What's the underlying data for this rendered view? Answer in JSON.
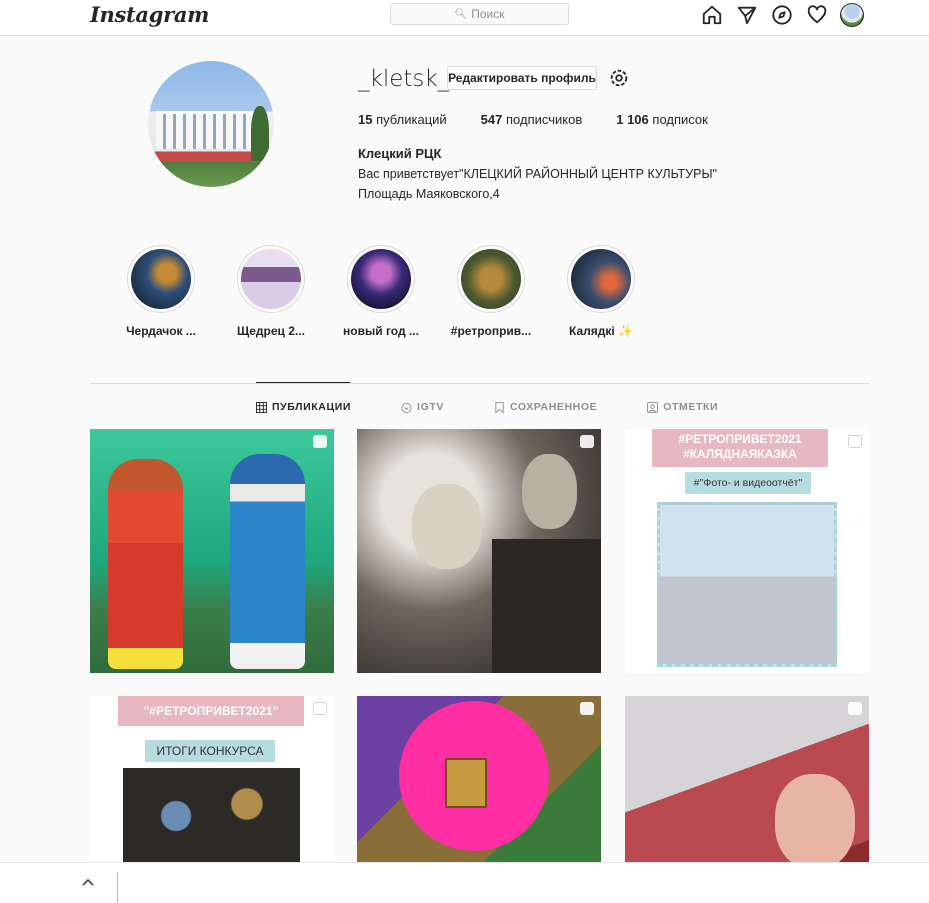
{
  "header": {
    "logo": "Instagram",
    "search_placeholder": "Поиск"
  },
  "profile": {
    "username": "_kletsk_",
    "edit_button": "Редактировать профиль",
    "stats": {
      "posts_count": "15",
      "posts_label": "публикаций",
      "followers_count": "547",
      "followers_label": "подписчиков",
      "following_count": "1 106",
      "following_label": "подписок"
    },
    "full_name": "Клецкий РЦК",
    "bio_line1": "Вас приветствует\"КЛЕЦКИЙ РАЙОННЫЙ ЦЕНТР КУЛЬТУРЫ\"",
    "bio_line2": "Площадь Маяковского,4"
  },
  "highlights": [
    {
      "label": "Чердачок ..."
    },
    {
      "label": "Щедрец 2..."
    },
    {
      "label": "новый год ..."
    },
    {
      "label": "#ретроприв..."
    },
    {
      "label": "Калядкі ✨"
    }
  ],
  "tabs": [
    {
      "label": "ПУБЛИКАЦИИ",
      "active": true
    },
    {
      "label": "IGTV",
      "active": false
    },
    {
      "label": "СОХРАНЕННОЕ",
      "active": false
    },
    {
      "label": "ОТМЕТКИ",
      "active": false
    }
  ],
  "posts": {
    "p3_banner_line1": "#РЕТРОПРИВЕТ2021",
    "p3_banner_line2": "#КАЛЯДНАЯКАЗКА",
    "p3_sub": "#\"Фото- и видеоотчёт\"",
    "p4_banner": "\"#РЕТРОПРИВЕТ2021\"",
    "p4_sub": "ИТОГИ КОНКУРСА"
  },
  "colors": {
    "text": "#262626",
    "muted": "#8e8e8e",
    "border": "#dbdbdb",
    "background": "#fafafa"
  }
}
